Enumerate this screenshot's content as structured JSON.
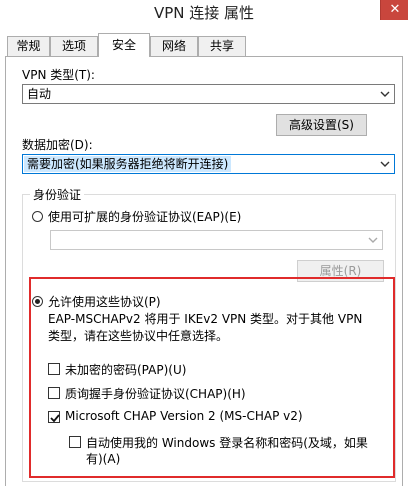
{
  "window": {
    "title": "VPN 连接 属性",
    "close_glyph": "✕"
  },
  "tabs": [
    {
      "label": "常规"
    },
    {
      "label": "选项"
    },
    {
      "label": "安全"
    },
    {
      "label": "网络"
    },
    {
      "label": "共享"
    }
  ],
  "vpn_type": {
    "label": "VPN 类型(T):",
    "value": "自动"
  },
  "advanced_button": "高级设置(S)",
  "encryption": {
    "label": "数据加密(D):",
    "value": "需要加密(如果服务器拒绝将断开连接)"
  },
  "auth": {
    "group_title": "身份验证",
    "eap_radio": "使用可扩展的身份验证协议(EAP)(E)",
    "eap_value": "",
    "properties_button": "属性(R)",
    "allow_radio": "允许使用这些协议(P)",
    "description_line1": "EAP-MSCHAPv2 将用于 IKEv2 VPN 类型。对于其他 VPN",
    "description_line2": "类型，请在这些协议中任意选择。",
    "pap": "未加密的密码(PAP)(U)",
    "chap": "质询握手身份验证协议(CHAP)(H)",
    "mschap": "Microsoft CHAP Version 2 (MS-CHAP v2)",
    "auto_logon_line1": "自动使用我的 Windows 登录名称和密码(及域，如果",
    "auto_logon_line2": "有)(A)"
  }
}
